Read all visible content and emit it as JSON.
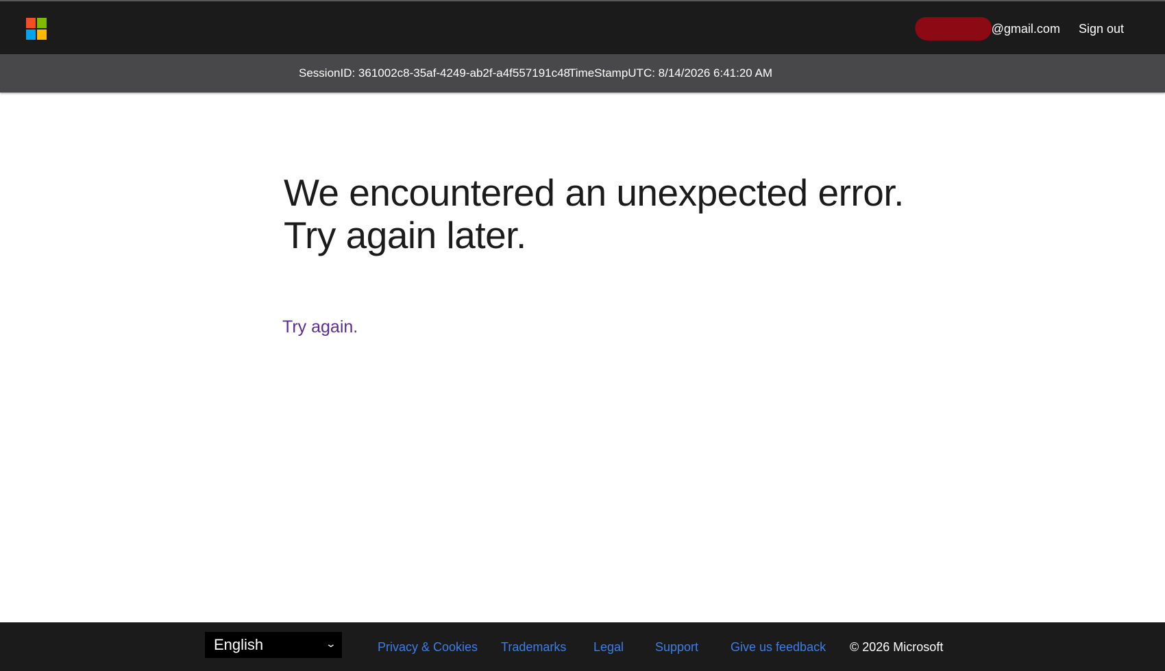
{
  "header": {
    "logo_colors": [
      "#f25022",
      "#7fba00",
      "#00a4ef",
      "#ffb900"
    ],
    "account_email": "@gmail.com",
    "sign_out_label": "Sign out",
    "redaction_color": "#8c0a14"
  },
  "session": {
    "session_id": "SessionID: 361002c8-35af-4249-ab2f-a4f557191c48",
    "timestamp": "TimeStampUTC: 8/14/2026 6:41:20 AM"
  },
  "main": {
    "title_line1": "We encountered an unexpected error.",
    "title_line2": "Try again later.",
    "retry_link": "Try again."
  },
  "footer": {
    "language": "English",
    "language_chevron_icon": "chevron-down-icon",
    "links": [
      "Privacy & Cookies",
      "Trademarks",
      "Legal",
      "Support",
      "Give us feedback"
    ],
    "copyright": "© 2026 Microsoft"
  },
  "colors": {
    "header_bg": "#1b1b1b",
    "session_bg": "#48484a",
    "link_blue": "#3e7ee6",
    "visited_purple": "#5b2d90"
  }
}
